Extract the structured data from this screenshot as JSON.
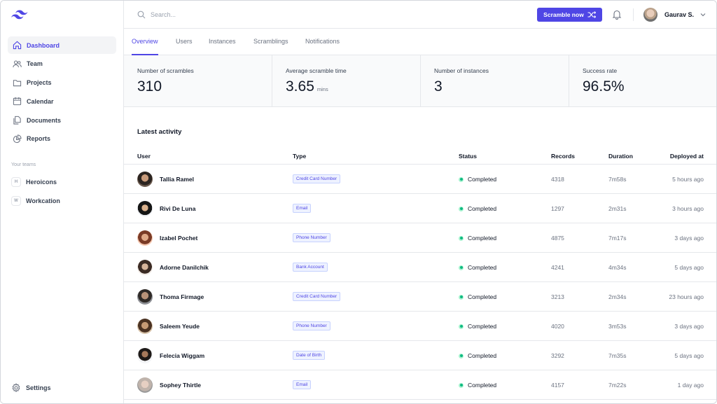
{
  "colors": {
    "accent": "#4f46e5",
    "status_green": "#10b981"
  },
  "sidebar": {
    "logo_icon": "tailwind-logo-icon",
    "nav": [
      {
        "label": "Dashboard",
        "icon": "home-icon",
        "active": true
      },
      {
        "label": "Team",
        "icon": "users-icon"
      },
      {
        "label": "Projects",
        "icon": "folder-icon"
      },
      {
        "label": "Calendar",
        "icon": "calendar-icon"
      },
      {
        "label": "Documents",
        "icon": "documents-icon"
      },
      {
        "label": "Reports",
        "icon": "chart-pie-icon"
      }
    ],
    "teams_heading": "Your teams",
    "teams": [
      {
        "badge": "H",
        "label": "Heroicons"
      },
      {
        "badge": "W",
        "label": "Workcation"
      }
    ],
    "settings_label": "Settings"
  },
  "topbar": {
    "search_placeholder": "Search...",
    "scramble_button": "Scramble now",
    "user_name": "Gaurav S."
  },
  "tabs": [
    "Overview",
    "Users",
    "Instances",
    "Scramblings",
    "Notifications"
  ],
  "active_tab": "Overview",
  "stats": [
    {
      "label": "Number of scrambles",
      "value": "310",
      "unit": ""
    },
    {
      "label": "Average scramble time",
      "value": "3.65",
      "unit": "mins"
    },
    {
      "label": "Number of instances",
      "value": "3",
      "unit": ""
    },
    {
      "label": "Success rate",
      "value": "96.5%",
      "unit": ""
    }
  ],
  "activity": {
    "title": "Latest activity",
    "columns": [
      "User",
      "Type",
      "Status",
      "Records",
      "Duration",
      "Deployed at"
    ],
    "rows": [
      {
        "user": "Tallia Ramel",
        "type": "Credit Card Number",
        "status": "Completed",
        "records": "4318",
        "duration": "7m58s",
        "deployed": "5 hours ago"
      },
      {
        "user": "Rivi De Luna",
        "type": "Email",
        "status": "Completed",
        "records": "1297",
        "duration": "2m31s",
        "deployed": "3 hours ago"
      },
      {
        "user": "Izabel Pochet",
        "type": "Phone Number",
        "status": "Completed",
        "records": "4875",
        "duration": "7m17s",
        "deployed": "3 days ago"
      },
      {
        "user": "Adorne Danilchik",
        "type": "Bank Account",
        "status": "Completed",
        "records": "4241",
        "duration": "4m34s",
        "deployed": "5 days ago"
      },
      {
        "user": "Thoma Firmage",
        "type": "Credit Card Number",
        "status": "Completed",
        "records": "3213",
        "duration": "2m34s",
        "deployed": "23 hours ago"
      },
      {
        "user": "Saleem Yeude",
        "type": "Phone Number",
        "status": "Completed",
        "records": "4020",
        "duration": "3m53s",
        "deployed": "3 days ago"
      },
      {
        "user": "Felecia Wiggam",
        "type": "Date of Birth",
        "status": "Completed",
        "records": "3292",
        "duration": "7m35s",
        "deployed": "5 days ago"
      },
      {
        "user": "Sophey Thirtle",
        "type": "Email",
        "status": "Completed",
        "records": "4157",
        "duration": "7m22s",
        "deployed": "1 day ago"
      }
    ]
  }
}
